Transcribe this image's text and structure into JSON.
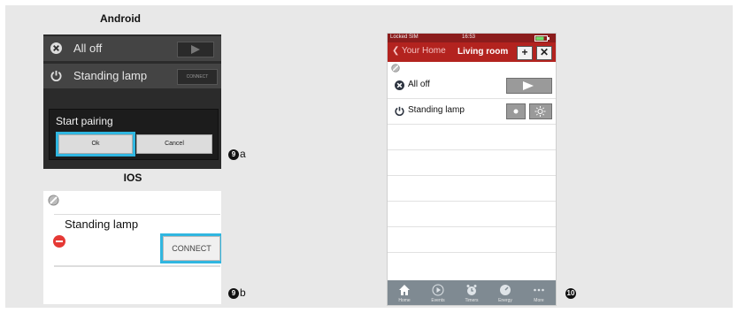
{
  "android": {
    "heading": "Android",
    "rows": [
      {
        "label": "All off"
      },
      {
        "label": "Standing lamp",
        "button": "CONNECT"
      }
    ],
    "dialog": {
      "title": "Start pairing",
      "ok": "Ok",
      "cancel": "Cancel"
    },
    "marker": {
      "number": "9",
      "suffix": "a"
    }
  },
  "ios": {
    "heading": "IOS",
    "item_label": "Standing lamp",
    "connect_button": "CONNECT",
    "marker": {
      "number": "9",
      "suffix": "b"
    }
  },
  "iphone": {
    "status": {
      "carrier": "Locked SIM",
      "time": "16:53"
    },
    "nav": {
      "back": "Your Home",
      "title": "Living room",
      "add": "+",
      "tools": "✕"
    },
    "rows": [
      {
        "label": "All off"
      },
      {
        "label": "Standing lamp"
      }
    ],
    "tabs": [
      "Home",
      "Events",
      "Timers",
      "Energy",
      "More"
    ],
    "marker": {
      "number": "10"
    }
  },
  "colors": {
    "highlight": "#30b6e0",
    "nav_red": "#b3231f",
    "tab_gray": "#7f8a92"
  }
}
